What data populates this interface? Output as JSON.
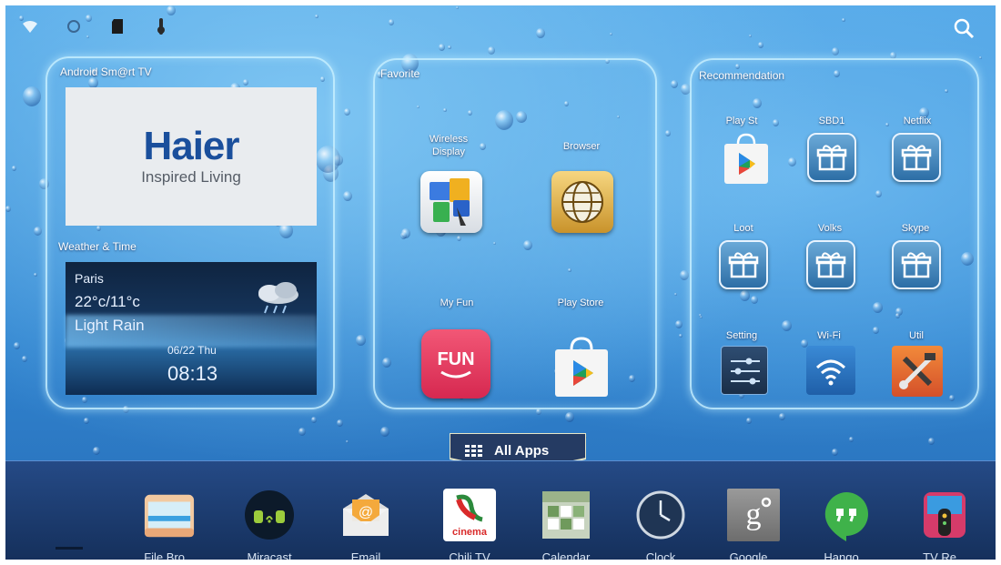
{
  "status_bar": {
    "icons": [
      "wifi-icon",
      "network-icon",
      "sd-card-icon",
      "usb-icon"
    ]
  },
  "panels": {
    "smart_tv": {
      "title": "Android Sm@rt TV",
      "brand_name": "Haier",
      "brand_tagline": "Inspired Living"
    },
    "weather": {
      "title": "Weather & Time",
      "city": "Paris",
      "temperature": "22°c/11°c",
      "condition": "Light Rain",
      "date": "06/22 Thu",
      "time": "08:13"
    },
    "favorite": {
      "title": "Favorite",
      "apps": [
        {
          "label": "Wireless Display",
          "icon": "wireless-display-icon"
        },
        {
          "label": "Browser",
          "icon": "browser-globe-icon"
        },
        {
          "label": "My Fun",
          "icon": "fun-icon",
          "icon_text": "FUN"
        },
        {
          "label": "Play Store",
          "icon": "play-store-icon"
        }
      ]
    },
    "recommendation": {
      "title": "Recommendation",
      "apps": [
        {
          "label": "Play St",
          "icon": "play-store-icon"
        },
        {
          "label": "SBD1",
          "icon": "gift-icon"
        },
        {
          "label": "Netflix",
          "icon": "gift-icon"
        },
        {
          "label": "Loot",
          "icon": "gift-icon"
        },
        {
          "label": "Volks",
          "icon": "gift-icon"
        },
        {
          "label": "Skype",
          "icon": "gift-icon"
        },
        {
          "label": "Setting",
          "icon": "settings-sliders-icon"
        },
        {
          "label": "Wi-Fi",
          "icon": "wifi-icon"
        },
        {
          "label": "Util",
          "icon": "tools-icon"
        }
      ]
    }
  },
  "all_apps": {
    "label": "All Apps",
    "icon": "grid-icon"
  },
  "dock": {
    "items": [
      {
        "label": "File Bro...",
        "icon": "folder-icon"
      },
      {
        "label": "Miracast",
        "icon": "miracast-icon"
      },
      {
        "label": "Email",
        "icon": "email-icon"
      },
      {
        "label": "Chili TV",
        "icon": "chili-tv-icon",
        "icon_text": "cinema"
      },
      {
        "label": "Calendar",
        "icon": "calendar-icon"
      },
      {
        "label": "Clock",
        "icon": "clock-icon"
      },
      {
        "label": "Google...",
        "icon": "google-settings-icon",
        "icon_text": "g"
      },
      {
        "label": "Hango...",
        "icon": "hangouts-icon"
      },
      {
        "label": "TV Re...",
        "icon": "tv-remote-icon"
      }
    ]
  },
  "colors": {
    "screen_blue": "#3b8fd8",
    "panel_glow": "#c8f0ff",
    "dock_bg": "#1d3c70",
    "brand_blue": "#1a4f9c",
    "fun_red": "#e8365a"
  }
}
